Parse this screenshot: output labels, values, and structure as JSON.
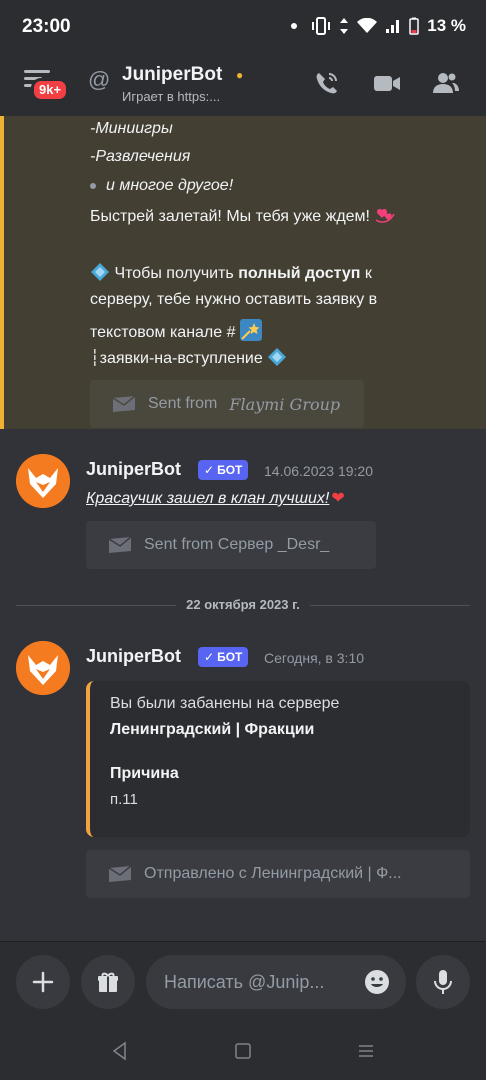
{
  "status_bar": {
    "time": "23:00",
    "battery": "13 %"
  },
  "header": {
    "channel_name": "JuniperBot",
    "subtitle": "Играет в https:...",
    "unread_badge": "9k+",
    "icons": [
      "hamburger-icon",
      "at-icon",
      "phone-call-icon",
      "video-icon",
      "members-icon"
    ]
  },
  "highlighted_message": {
    "lines": [
      "-Миниигры",
      "-Развлечения",
      "и многое другое!",
      "Быстрей залетай! Мы тебя уже ждем!",
      "Чтобы получить ",
      "полный доступ",
      " к",
      "серверу, тебе нужно оставить заявку в",
      "текстовом канале #",
      "┆заявки-на-вступление"
    ],
    "sent_from_prefix": "Sent from",
    "sent_from_server": "Flaymi Group"
  },
  "messages": [
    {
      "author": "JuniperBot",
      "bot_tag": "БОТ",
      "timestamp": "14.06.2023 19:20",
      "text": "Красаучик зашел в клан лучших!",
      "sent_from": "Sent from Сервер _Desr_"
    },
    {
      "author": "JuniperBot",
      "bot_tag": "БОТ",
      "timestamp": "Сегодня, в 3:10",
      "embed": {
        "line1": "Вы были забанены на сервере",
        "line2": "Ленинградский | Фракции",
        "field_name": "Причина",
        "field_value": "п.11"
      },
      "sent_from": "Отправлено с Ленинградский | Ф..."
    }
  ],
  "date_divider": "22 октября 2023 г.",
  "composer": {
    "placeholder": "Написать @Junip..."
  },
  "colors": {
    "accent": "#5865f2",
    "highlight": "#f0b232",
    "embed_border": "#f0a440",
    "avatar": "#f47b20"
  }
}
